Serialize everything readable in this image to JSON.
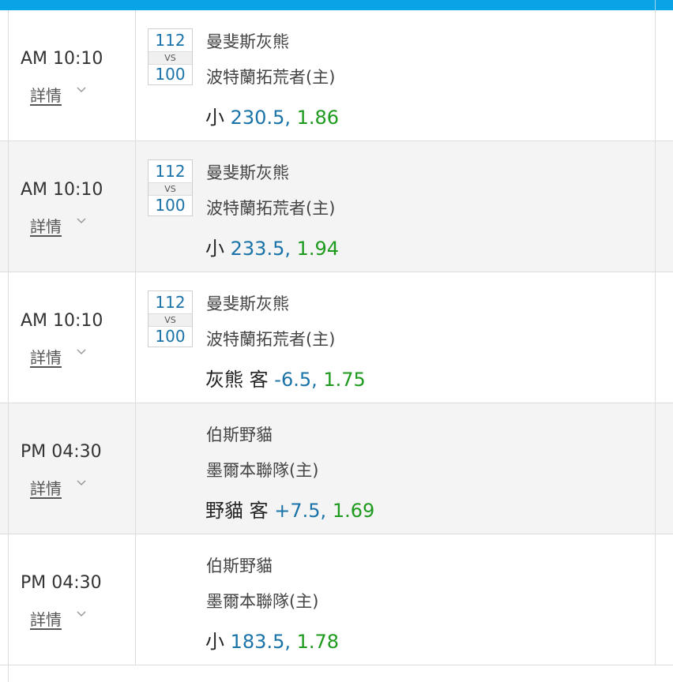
{
  "details_label": "詳情",
  "colors": {
    "header": "#0aa4e6",
    "line": "#1a73a8",
    "odds": "#1e9a1e"
  },
  "matches": [
    {
      "time": "AM 10:10",
      "score_away": "112",
      "vs": "VS",
      "score_home": "100",
      "team_away": "曼斐斯灰熊",
      "team_home": "波特蘭拓荒者(主)",
      "bet_pick": "小",
      "bet_line": "230.5,",
      "bet_odds": "1.86"
    },
    {
      "time": "AM 10:10",
      "score_away": "112",
      "vs": "VS",
      "score_home": "100",
      "team_away": "曼斐斯灰熊",
      "team_home": "波特蘭拓荒者(主)",
      "bet_pick": "小",
      "bet_line": "233.5,",
      "bet_odds": "1.94"
    },
    {
      "time": "AM 10:10",
      "score_away": "112",
      "vs": "VS",
      "score_home": "100",
      "team_away": "曼斐斯灰熊",
      "team_home": "波特蘭拓荒者(主)",
      "bet_pick": "灰熊 客",
      "bet_line": "-6.5,",
      "bet_odds": "1.75"
    },
    {
      "time": "PM 04:30",
      "team_away": "伯斯野貓",
      "team_home": "墨爾本聯隊(主)",
      "bet_pick": "野貓 客",
      "bet_line": "+7.5,",
      "bet_odds": "1.69"
    },
    {
      "time": "PM 04:30",
      "team_away": "伯斯野貓",
      "team_home": "墨爾本聯隊(主)",
      "bet_pick": "小",
      "bet_line": "183.5,",
      "bet_odds": "1.78"
    }
  ]
}
